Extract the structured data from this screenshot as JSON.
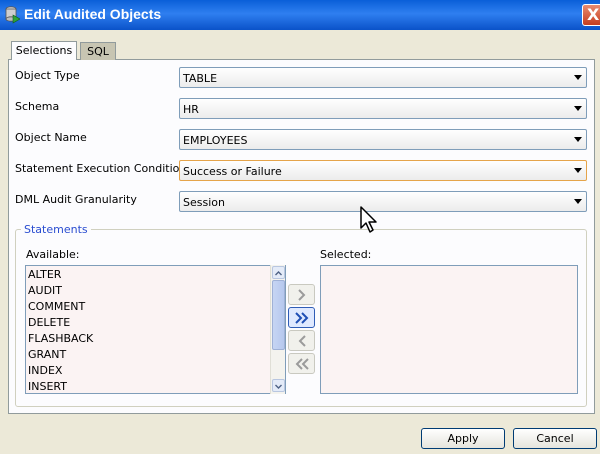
{
  "window": {
    "title": "Edit Audited Objects",
    "close_glyph": "X"
  },
  "tabs": [
    {
      "label": "Selections"
    },
    {
      "label": "SQL"
    }
  ],
  "fields": {
    "object_type": {
      "label": "Object Type",
      "value": "TABLE"
    },
    "schema": {
      "label": "Schema",
      "value": "HR"
    },
    "object_name": {
      "label": "Object Name",
      "value": "EMPLOYEES"
    },
    "statement_execution_condition": {
      "label": "Statement Execution Condition",
      "value": "Success or Failure"
    },
    "dml_audit_granularity": {
      "label": "DML Audit Granularity",
      "value": "Session"
    }
  },
  "statements": {
    "group_title": "Statements",
    "available_label": "Available:",
    "selected_label": "Selected:",
    "available": [
      "ALTER",
      "AUDIT",
      "COMMENT",
      "DELETE",
      "FLASHBACK",
      "GRANT",
      "INDEX",
      "INSERT"
    ],
    "selected": []
  },
  "buttons": {
    "apply": "Apply",
    "cancel": "Cancel"
  },
  "icons": [
    "app-icon",
    "close-icon",
    "move-right-icon",
    "move-all-right-icon",
    "move-left-icon",
    "move-all-left-icon",
    "mouse-cursor-icon"
  ],
  "colors": {
    "titlebar": "#0a5fd8",
    "list_background": "#fbf3f3",
    "focus_border": "#e5a44a",
    "group_title": "#2a4dd0"
  }
}
